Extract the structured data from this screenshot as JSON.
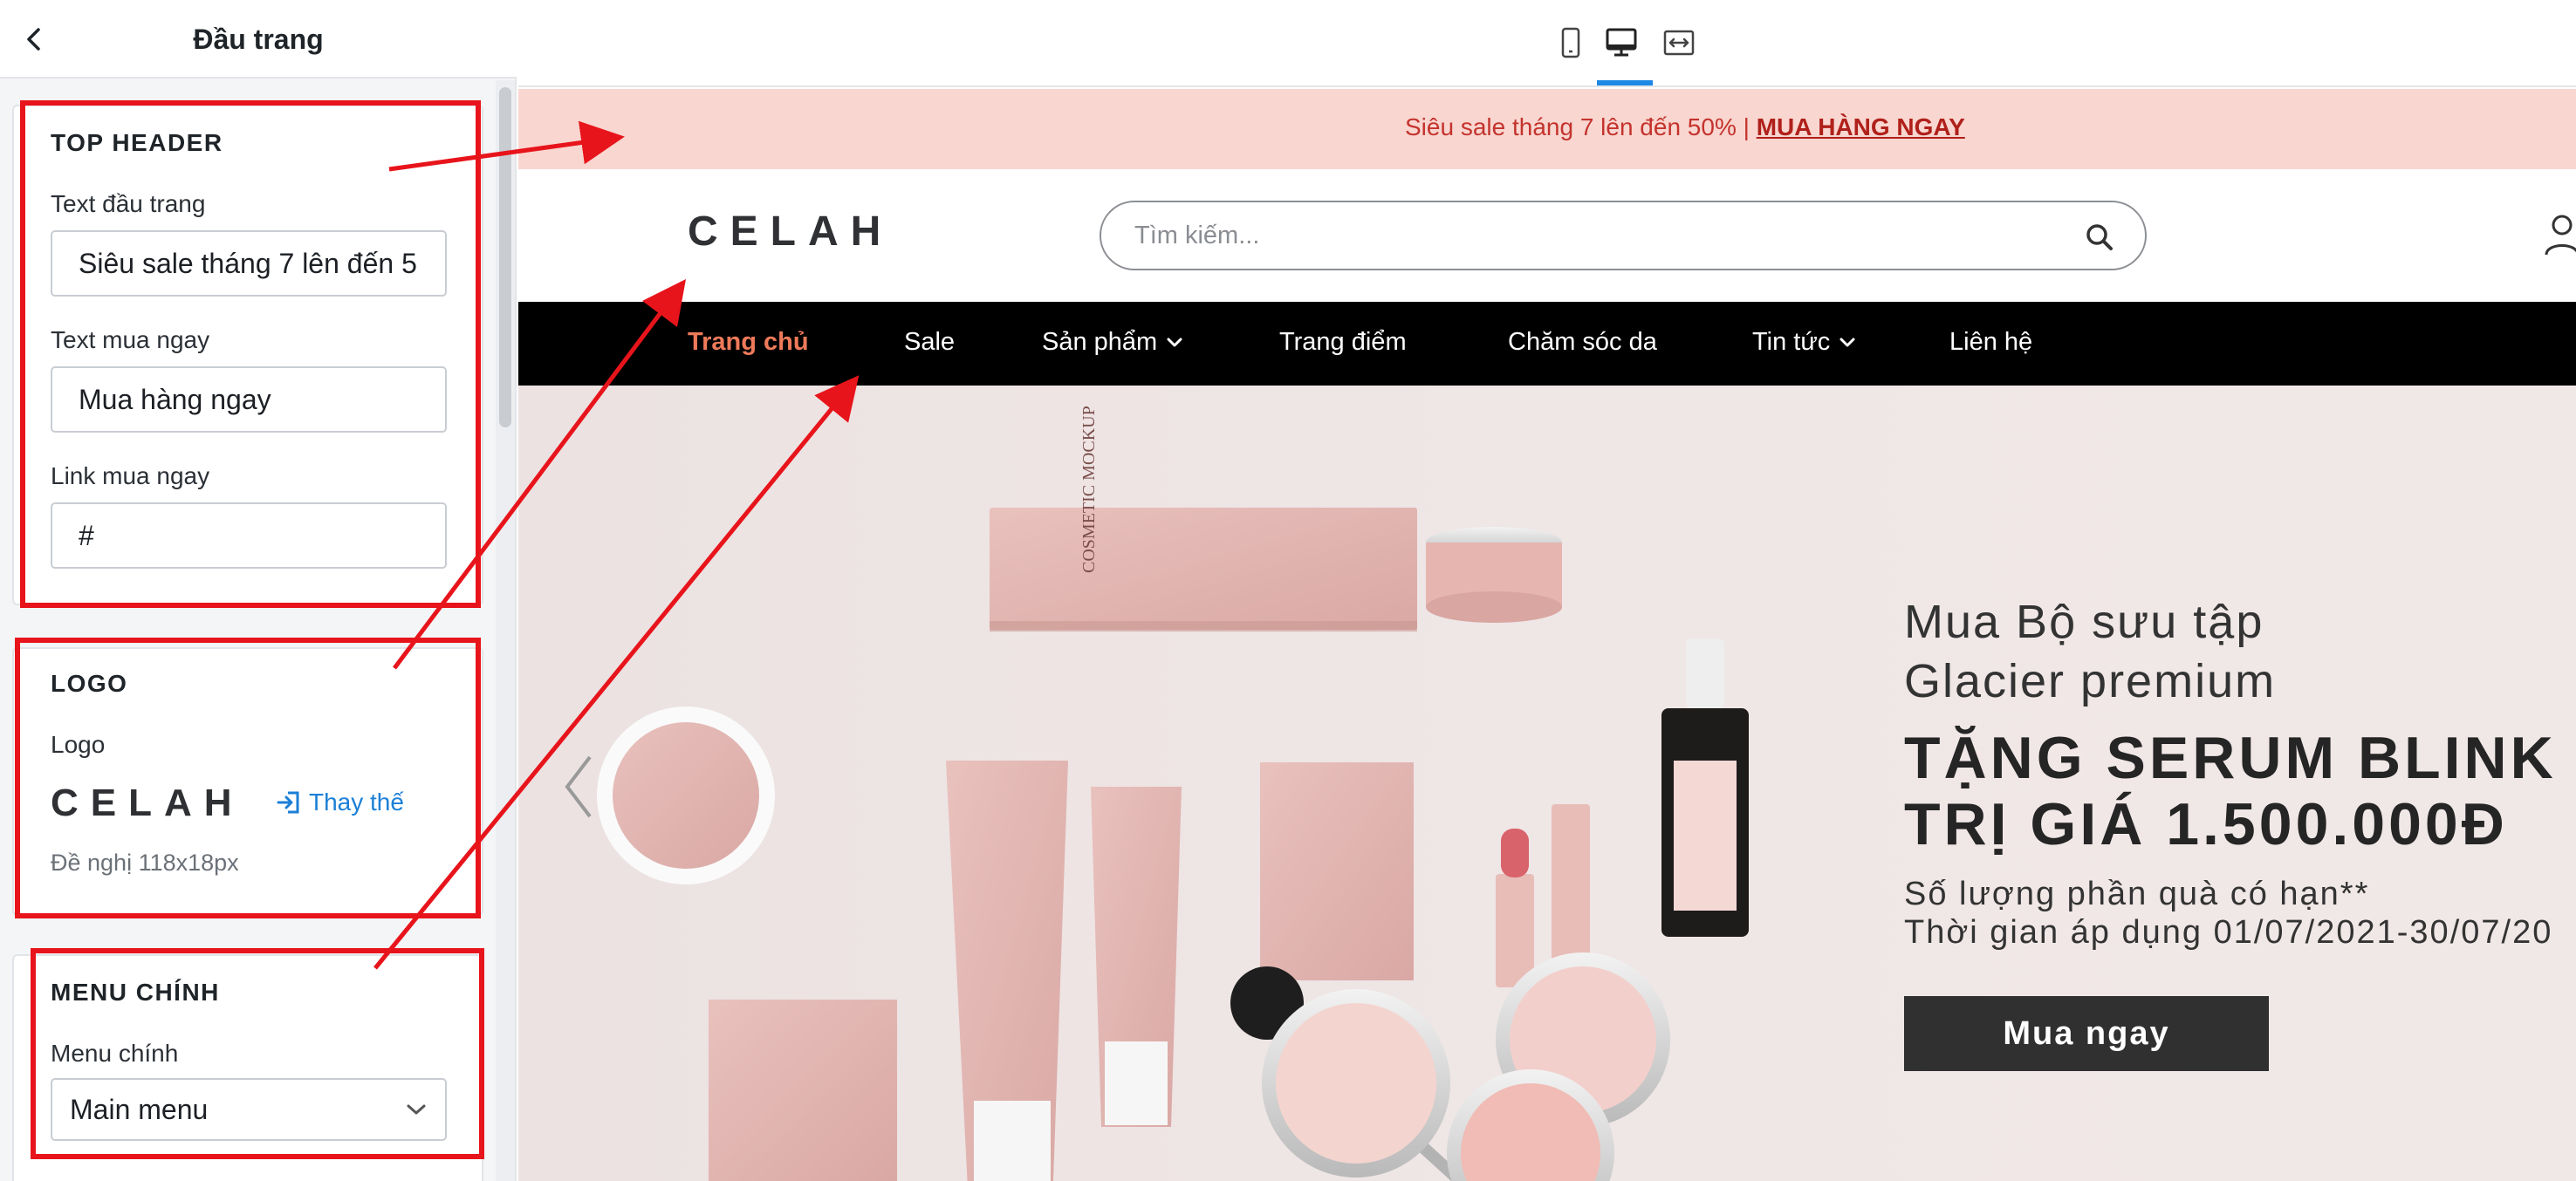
{
  "sidebar": {
    "title": "Đầu trang",
    "back_icon": "chevron-left-icon",
    "top_header": {
      "section_title": "TOP HEADER",
      "text_label": "Text đầu trang",
      "text_value": "Siêu sale tháng 7 lên đến 5",
      "buy_label": "Text mua ngay",
      "buy_value": "Mua hàng ngay",
      "link_label": "Link mua ngay",
      "link_value": "#"
    },
    "logo": {
      "section_title": "LOGO",
      "label": "Logo",
      "preview_text": "CELAH",
      "replace_label": "Thay thế",
      "hint": "Đề nghị 118x18px"
    },
    "main_menu": {
      "section_title": "MENU CHÍNH",
      "label": "Menu chính",
      "selected": "Main menu"
    }
  },
  "toolbar": {
    "devices": [
      "mobile-icon",
      "desktop-icon",
      "fullwidth-icon"
    ],
    "active_device": "desktop"
  },
  "preview": {
    "announcement": {
      "text": "Siêu sale tháng 7 lên đến 50% | ",
      "link": "MUA HÀNG NGAY"
    },
    "logo": "CELAH",
    "search_placeholder": "Tìm kiếm...",
    "nav": [
      {
        "label": "Trang chủ"
      },
      {
        "label": "Sale"
      },
      {
        "label": "Sản phẩm"
      },
      {
        "label": "Trang điểm"
      },
      {
        "label": "Chăm sóc da"
      },
      {
        "label": "Tin tức"
      },
      {
        "label": "Liên hệ"
      }
    ],
    "hero": {
      "line1": "Mua Bộ sưu tập",
      "line2": "Glacier premium",
      "line3": "TẶNG SERUM BLINK",
      "line4": "TRỊ GIÁ 1.500.000Đ",
      "line5": "Số lượng phần quà có hạn**",
      "line6": "Thời gian áp dụng 01/07/2021-30/07/20",
      "cta": "Mua ngay",
      "product_text": "COSMETIC MOCKUP"
    }
  },
  "colors": {
    "annotation_red": "#e8141b",
    "topbar_bg": "#f9d6d0",
    "nav_active": "#ee7a5a",
    "link_blue": "#1b7fd6",
    "active_tab": "#1e88e5"
  }
}
